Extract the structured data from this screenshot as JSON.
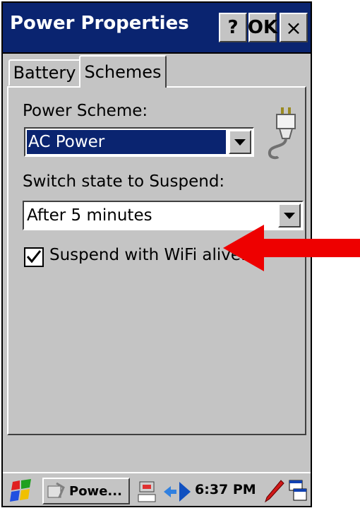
{
  "window": {
    "title": "Power Properties",
    "help_label": "?",
    "ok_label": "OK",
    "close_label": "×"
  },
  "tabs": [
    {
      "label": "Battery",
      "active": false
    },
    {
      "label": "Schemes",
      "active": true
    }
  ],
  "schemes": {
    "power_scheme_label": "Power Scheme:",
    "power_scheme_value": "AC Power",
    "suspend_label": "Switch state to Suspend:",
    "suspend_value": "After 5 minutes",
    "wifi_checkbox_label": "Suspend with WiFi alive.",
    "wifi_checkbox_checked": true
  },
  "taskbar": {
    "app_label": "Powe...",
    "time": "6:37 PM"
  },
  "colors": {
    "title_bar": "#0a2470",
    "face": "#c4c4c4",
    "highlight": "#0a2470",
    "annotation_arrow": "#ee0000"
  },
  "icons": [
    "power-plug-icon",
    "windows-start-icon",
    "power-app-icon",
    "network-icon",
    "connection-arrow-icon",
    "pen-input-icon",
    "window-switch-icon"
  ]
}
